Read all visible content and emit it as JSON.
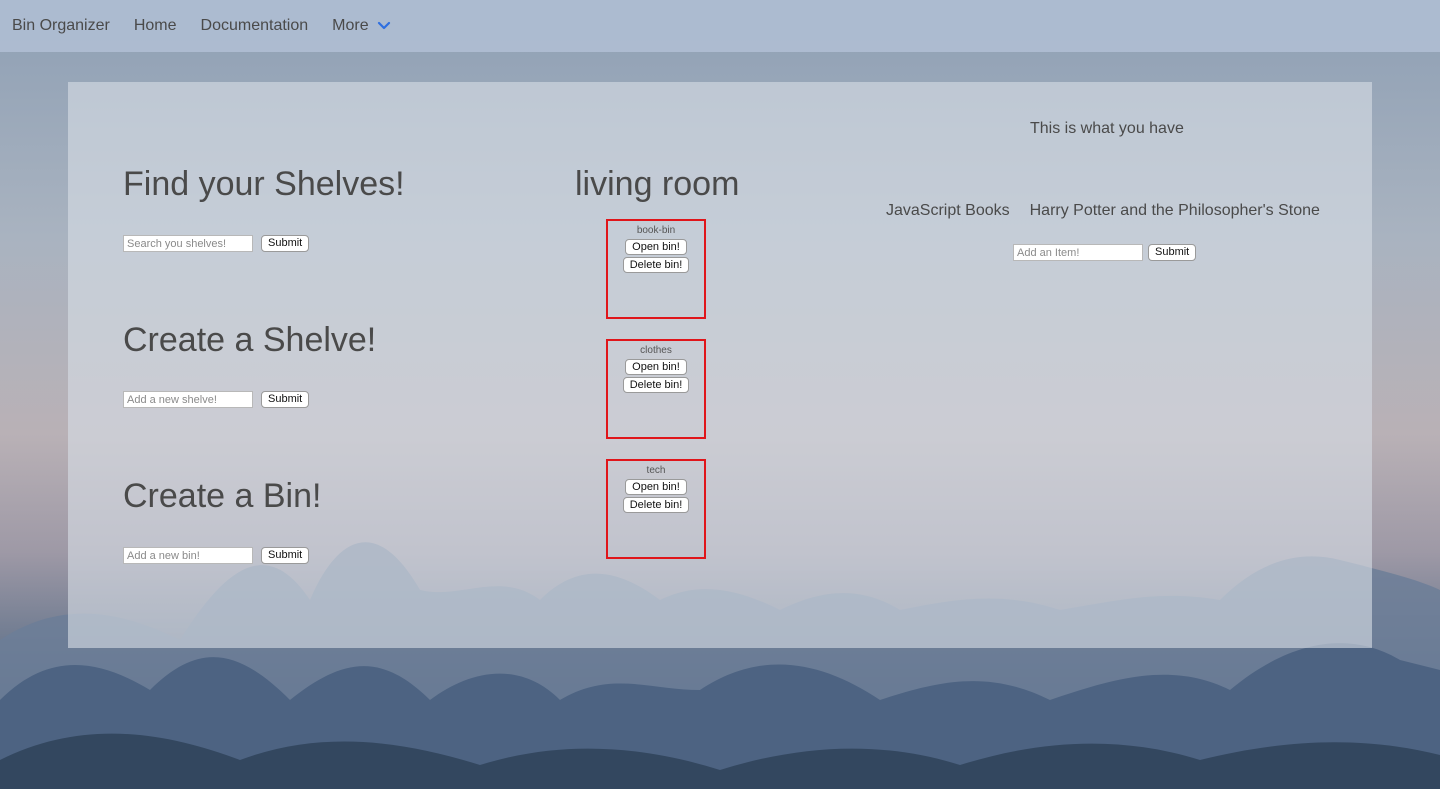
{
  "navbar": {
    "brand": "Bin Organizer",
    "home": "Home",
    "documentation": "Documentation",
    "more": "More",
    "more_icon": "chevron-down-icon",
    "accent_color": "#2f6fe0"
  },
  "left": {
    "find": {
      "title": "Find your Shelves!",
      "placeholder": "Search you shelves!",
      "value": "",
      "submit_label": "Submit"
    },
    "create_shelve": {
      "title": "Create a Shelve!",
      "placeholder": "Add a new shelve!",
      "value": "",
      "submit_label": "Submit"
    },
    "create_bin": {
      "title": "Create a Bin!",
      "placeholder": "Add a new bin!",
      "value": "",
      "submit_label": "Submit"
    }
  },
  "shelf": {
    "title": "living room",
    "bin_border_color": "#e0151a",
    "bins": [
      {
        "name": "book-bin",
        "open_label": "Open bin!",
        "delete_label": "Delete bin!"
      },
      {
        "name": "clothes",
        "open_label": "Open bin!",
        "delete_label": "Delete bin!"
      },
      {
        "name": "tech",
        "open_label": "Open bin!",
        "delete_label": "Delete bin!"
      }
    ]
  },
  "contents": {
    "title": "This is what you have",
    "items": [
      "JavaScript Books",
      "Harry Potter and the Philosopher's Stone"
    ],
    "placeholder": "Add an Item!",
    "value": "",
    "submit_label": "Submit"
  }
}
